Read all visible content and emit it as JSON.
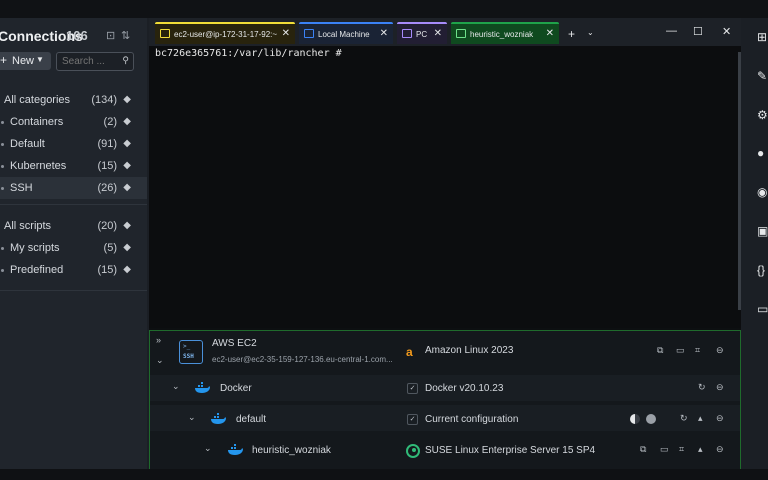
{
  "sidebar": {
    "title": "Connections",
    "count": "106",
    "new_button": "New",
    "search_placeholder": "Search ...",
    "categories": [
      {
        "label": "All categories",
        "count": "(134)"
      },
      {
        "label": "Containers",
        "count": "(2)"
      },
      {
        "label": "Default",
        "count": "(91)"
      },
      {
        "label": "Kubernetes",
        "count": "(15)"
      },
      {
        "label": "SSH",
        "count": "(26)"
      }
    ],
    "scripts": [
      {
        "label": "All scripts",
        "count": "(20)"
      },
      {
        "label": "My scripts",
        "count": "(5)"
      },
      {
        "label": "Predefined",
        "count": "(15)"
      }
    ]
  },
  "tabs": [
    {
      "label": "ec2-user@ip-172-31-17-92:~",
      "color": "#f1dd38"
    },
    {
      "label": "Local Machine",
      "color": "#3b82f6"
    },
    {
      "label": "PC",
      "color": "#a78bfa"
    },
    {
      "label": "heuristic_wozniak",
      "color": "#1fa34a"
    }
  ],
  "terminal": {
    "prompt": "bc726e365761:/var/lib/rancher #"
  },
  "panel": {
    "aws": {
      "title": "AWS EC2",
      "subtitle": "ec2-user@ec2-35-159-127-136.eu-central-1.com...",
      "os": "Amazon Linux 2023",
      "ssh_label": "SSH"
    },
    "docker": {
      "title": "Docker",
      "version": "Docker v20.10.23"
    },
    "default": {
      "title": "default",
      "config": "Current  configuration"
    },
    "container": {
      "title": "heuristic_wozniak",
      "os": "SUSE Linux Enterprise Server 15 SP4"
    }
  },
  "colors": {
    "accent_green": "#1fa34a",
    "docker_blue": "#2496ed"
  }
}
